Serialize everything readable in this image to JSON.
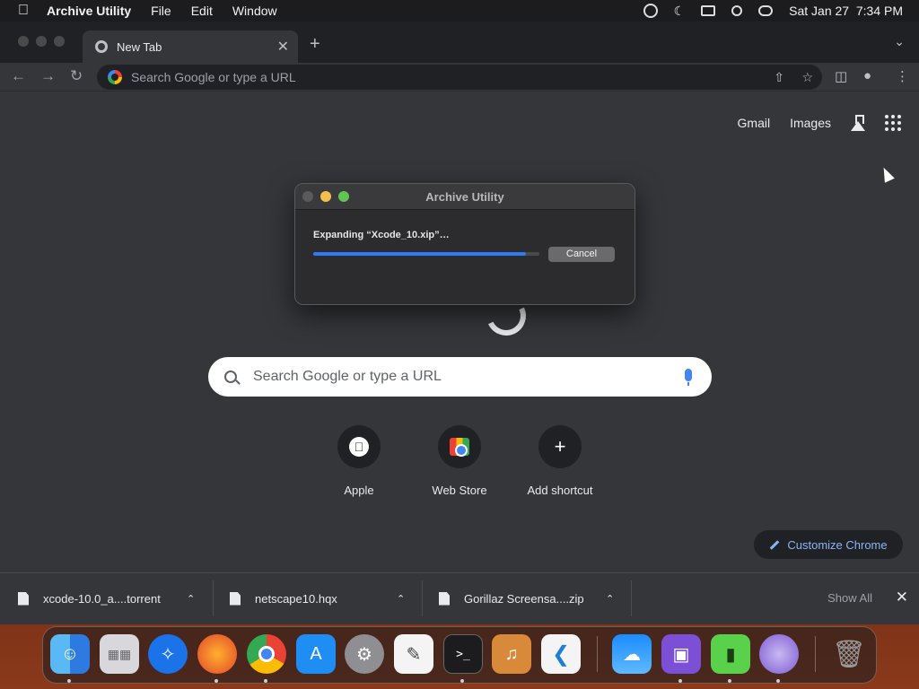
{
  "menubar": {
    "app_name": "Archive Utility",
    "menus": [
      "File",
      "Edit",
      "Window"
    ],
    "datetime": "Sat Jan 27  7:34 PM"
  },
  "chrome": {
    "tab_title": "New Tab",
    "omnibox_placeholder": "Search Google or type a URL",
    "header_links": {
      "gmail": "Gmail",
      "images": "Images"
    },
    "search_placeholder": "Search Google or type a URL",
    "shortcuts": [
      {
        "label": "Apple",
        "icon": "apple-icon"
      },
      {
        "label": "Web Store",
        "icon": "web-store-icon"
      },
      {
        "label": "Add shortcut",
        "icon": "plus-icon"
      }
    ],
    "customize_label": "Customize Chrome"
  },
  "downloads": {
    "items": [
      {
        "name": "xcode-10.0_a....torrent"
      },
      {
        "name": "netscape10.hqx"
      },
      {
        "name": "Gorillaz Screensa....zip"
      }
    ],
    "show_all": "Show All"
  },
  "dialog": {
    "title": "Archive Utility",
    "message": "Expanding “Xcode_10.xip”…",
    "progress": 0.94,
    "cancel_label": "Cancel"
  },
  "dock": {
    "apps": [
      "Finder",
      "Launchpad",
      "Safari",
      "Firefox",
      "Chrome",
      "App Store",
      "System Settings",
      "TextEdit",
      "Terminal",
      "GarageBand",
      "VS Code",
      "Weather",
      "Archive Utility",
      "Keka",
      "Transmission",
      "Trash"
    ]
  },
  "colors": {
    "accent_blue": "#2f7bf5",
    "link_blue": "#8ab4f8",
    "chrome_bg": "#35363a"
  }
}
